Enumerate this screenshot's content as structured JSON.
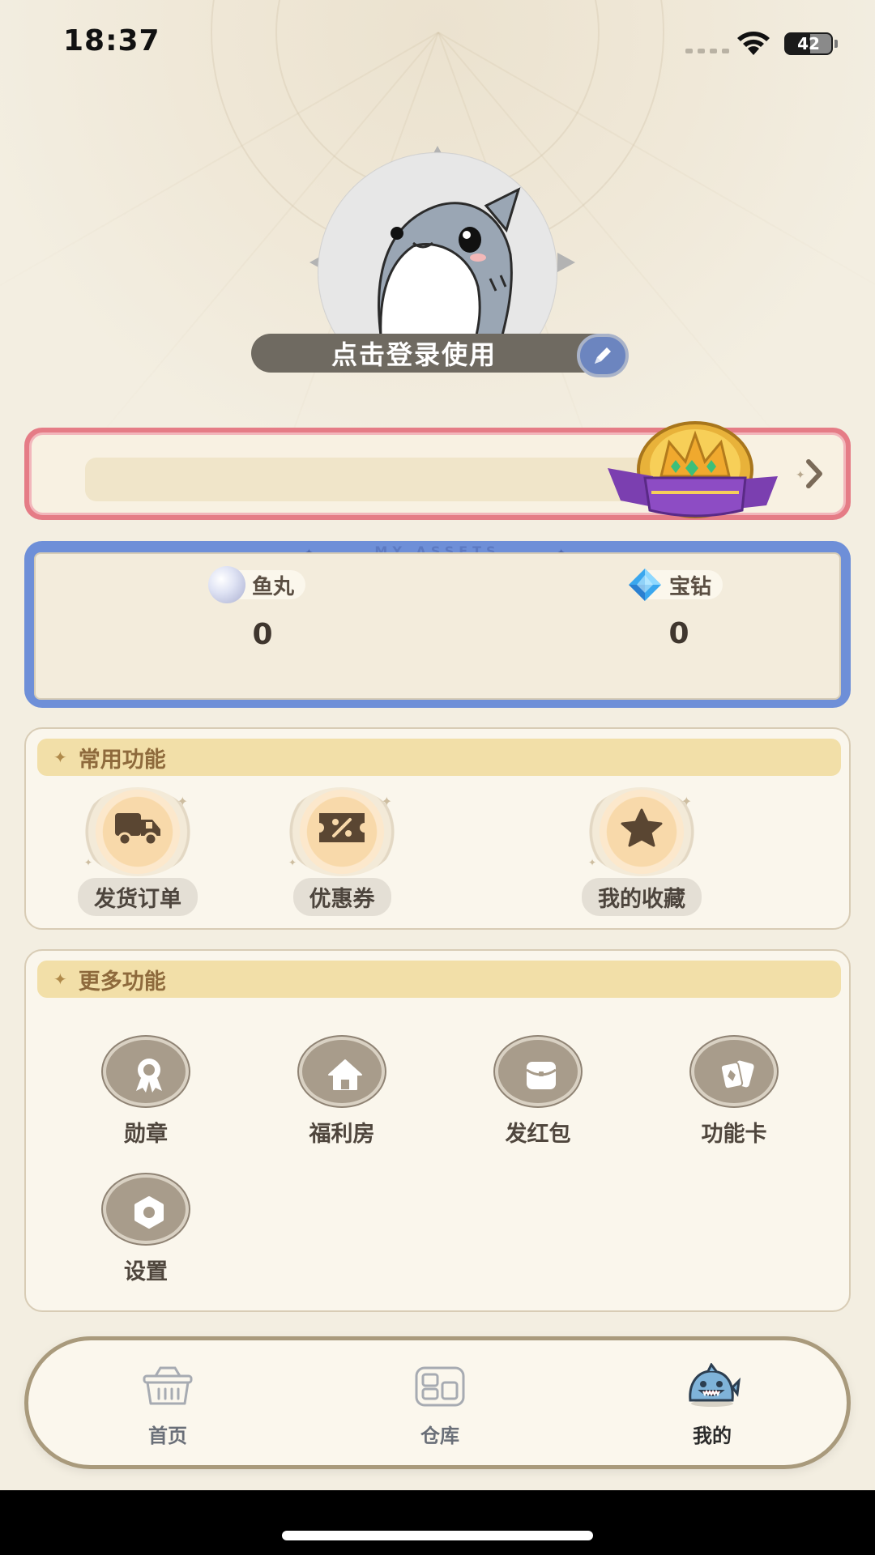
{
  "status_bar": {
    "time": "18:37",
    "battery": "42"
  },
  "profile": {
    "login_label": "点击登录使用"
  },
  "assets": {
    "title": "MY ASSETS",
    "items": [
      {
        "label": "鱼丸",
        "value": "0",
        "icon": "pearl-icon"
      },
      {
        "label": "宝钻",
        "value": "0",
        "icon": "diamond-icon"
      }
    ]
  },
  "common": {
    "title": "常用功能",
    "items": [
      {
        "label": "发货订单",
        "icon": "truck-icon"
      },
      {
        "label": "优惠券",
        "icon": "coupon-icon"
      },
      {
        "label": "我的收藏",
        "icon": "star-icon"
      }
    ]
  },
  "more": {
    "title": "更多功能",
    "items": [
      {
        "label": "勋章",
        "icon": "medal-icon"
      },
      {
        "label": "福利房",
        "icon": "house-icon"
      },
      {
        "label": "发红包",
        "icon": "red-envelope-icon"
      },
      {
        "label": "功能卡",
        "icon": "cards-icon"
      },
      {
        "label": "设置",
        "icon": "settings-icon"
      }
    ]
  },
  "tabbar": {
    "items": [
      {
        "label": "首页",
        "icon": "basket-icon",
        "active": false
      },
      {
        "label": "仓库",
        "icon": "warehouse-icon",
        "active": false
      },
      {
        "label": "我的",
        "icon": "shark-mascot-icon",
        "active": true
      }
    ]
  },
  "colors": {
    "vip_border": "#e57c86",
    "assets_border": "#6e8fd8",
    "section_header": "#f2dfa8",
    "tabbar_border": "#a99a7c"
  }
}
